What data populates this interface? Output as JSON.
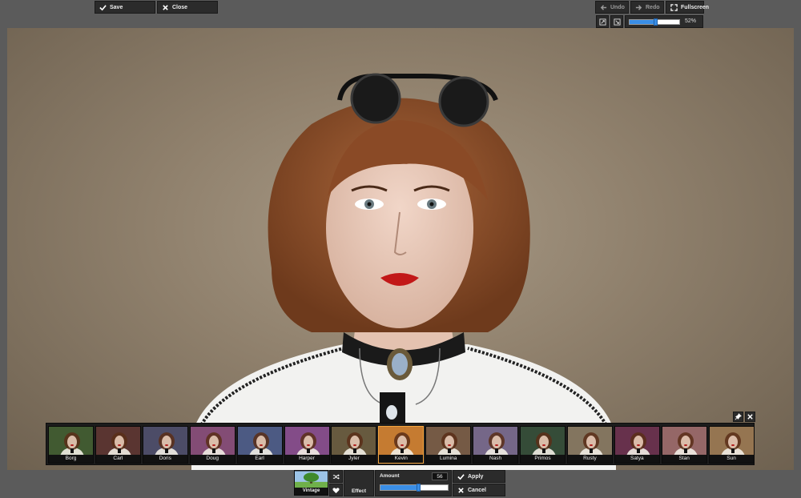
{
  "toolbar": {
    "save_label": "Save",
    "close_label": "Close",
    "undo_label": "Undo",
    "redo_label": "Redo",
    "fullscreen_label": "Fullscreen",
    "zoom_value": 0.52,
    "zoom_label": "52%"
  },
  "icons": {
    "save": "check-icon",
    "close": "x-icon",
    "undo": "arrow-left-icon",
    "redo": "arrow-right-icon",
    "fullscreen": "expand-icon",
    "fit": "fit-icon",
    "actual_size": "actual-size-icon",
    "pin": "pin-icon",
    "strip_close": "x-icon",
    "shuffle": "shuffle-icon",
    "favorite": "heart-icon"
  },
  "filters": [
    {
      "label": "Borg",
      "tint": "#4d6a3a"
    },
    {
      "label": "Carl",
      "tint": "#6a3f3a"
    },
    {
      "label": "Doris",
      "tint": "#5a5a7a"
    },
    {
      "label": "Doug",
      "tint": "#9a5a8a"
    },
    {
      "label": "Earl",
      "tint": "#5a6a9a"
    },
    {
      "label": "Harper",
      "tint": "#9a5aa0"
    },
    {
      "label": "Jyler",
      "tint": "#7a6a4a"
    },
    {
      "label": "Kevin",
      "tint": "#e8913a"
    },
    {
      "label": "Lumina",
      "tint": "#8a6a52"
    },
    {
      "label": "Nash",
      "tint": "#8a7aa0"
    },
    {
      "label": "Primos",
      "tint": "#3f5a42"
    },
    {
      "label": "Rusty",
      "tint": "#9a8a70"
    },
    {
      "label": "Satya",
      "tint": "#7a3a5a"
    },
    {
      "label": "Stan",
      "tint": "#b07a7a"
    },
    {
      "label": "Sun",
      "tint": "#b08a60"
    }
  ],
  "selected_filter": "Kevin",
  "effect_panel": {
    "category_label": "Vintage",
    "effect_label": "Effect",
    "amount_label": "Amount",
    "amount_value": "56",
    "amount_fraction": 0.56,
    "apply_label": "Apply",
    "cancel_label": "Cancel"
  },
  "colors": {
    "background": "#5b5b5b",
    "panel": "#2b2b2b",
    "accent_blue": "#3a8ee6",
    "selected_border": "#f4a640"
  }
}
